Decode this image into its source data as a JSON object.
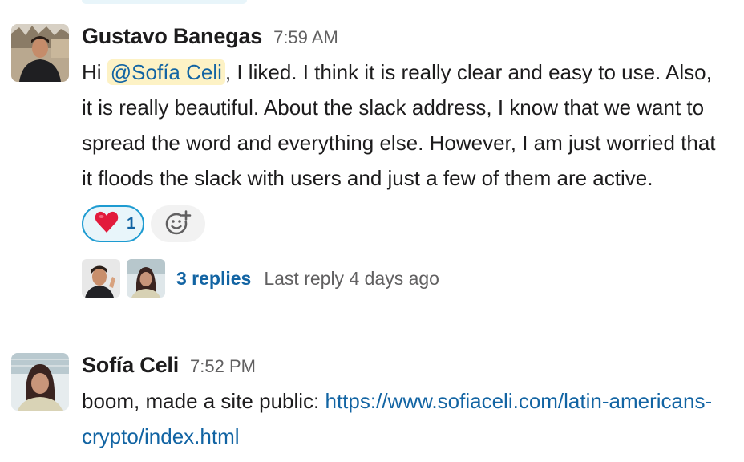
{
  "messages": [
    {
      "author": "Gustavo Banegas",
      "time": "7:59 AM",
      "text_before": "Hi ",
      "mention": "@Sofía Celi",
      "text_after": ", I liked. I think it is really clear and easy to use. Also, it is really beautiful. About the slack address, I know that we want to spread the word and everything else. However, I am just worried that it floods the slack with users and just a few of them are active.",
      "reaction": {
        "emoji": "heart-icon",
        "count": "1"
      },
      "thread": {
        "replies": "3 replies",
        "last_reply": "Last reply 4 days ago"
      }
    },
    {
      "author": "Sofía Celi",
      "time": "7:52 PM",
      "text": "boom, made a site public: ",
      "link": "https://www.sofiaceli.com/latin-americans-crypto/index.html"
    }
  ],
  "colors": {
    "link": "#1264a3",
    "mention_bg": "#fdf2c5",
    "reaction_border": "#1d9bd1",
    "reaction_bg": "#e8f5fa",
    "muted": "#616061"
  }
}
